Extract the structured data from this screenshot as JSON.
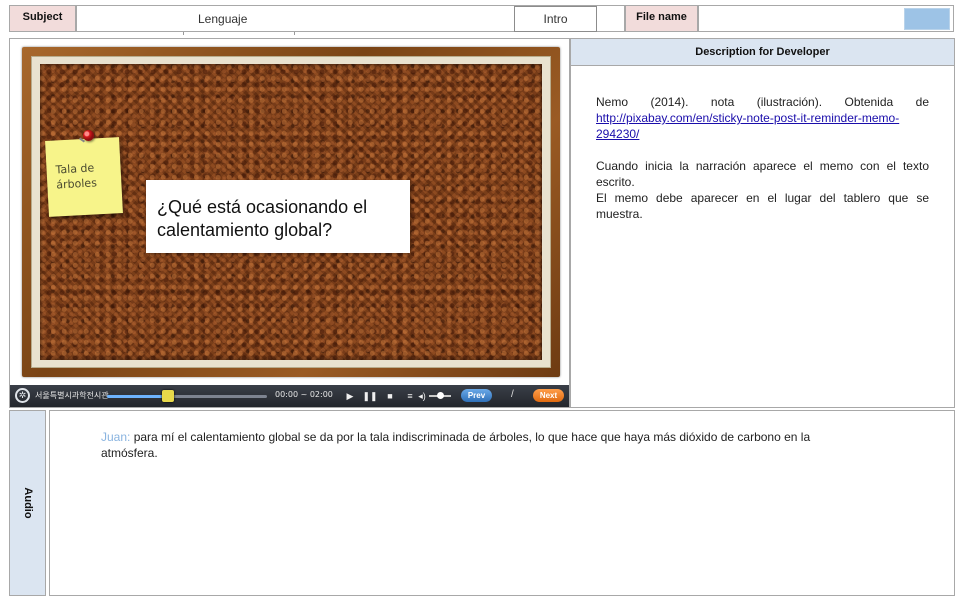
{
  "header": {
    "subject_label": "Subject",
    "subject_value": "Lenguaje",
    "intro_label": "Intro",
    "file_name_label": "File name",
    "file_name_value": ""
  },
  "board": {
    "sticky_note_text": "Tala de árboles",
    "question_text": "¿Qué está ocasionando el calentamiento global?"
  },
  "player": {
    "brand_text": "서울특별시과학전시관",
    "time_text": "00:00 ~ 02:00",
    "progress_fraction": 0.38,
    "volume_fraction": 0.5,
    "prev_label": "Prev",
    "separator": "/",
    "next_label": "Next"
  },
  "description": {
    "header": "Description for Developer",
    "credit_text": "Nemo (2014). nota (ilustración). Obtenida de",
    "link_text": "http://pixabay.com/en/sticky-note-post-it-reminder-memo-294230/",
    "paragraph_1": "Cuando inicia la narración aparece el memo con el texto escrito.",
    "paragraph_2": "El memo debe aparecer en el lugar del tablero que se muestra."
  },
  "audio": {
    "label": "Audio",
    "speaker": "Juan:",
    "line": "para mí el calentamiento global se da por la tala indiscriminada de árboles, lo que hace que haya más dióxido de carbono en la atmósfera."
  },
  "colors": {
    "label_pink": "#f2dcdb",
    "label_blue": "#dbe5f1",
    "file_swatch": "#9dc3e6",
    "speaker_blue": "#8ab4e0",
    "sticky_yellow": "#f7f48a",
    "cork_brown": "#7a3d18"
  }
}
